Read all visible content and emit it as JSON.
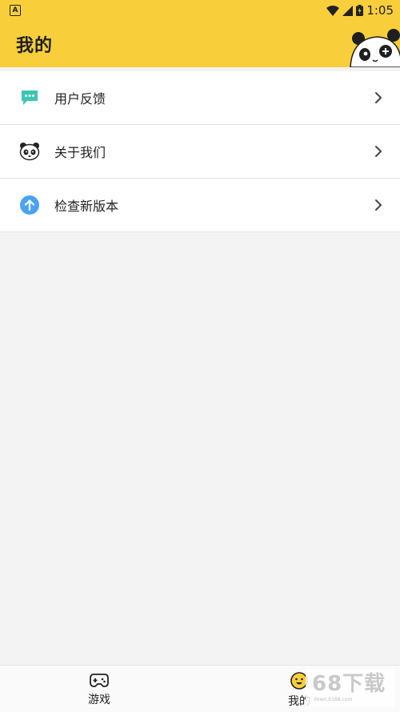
{
  "status_bar": {
    "time": "1:05",
    "notification_icon": "app-notification-icon",
    "notification_letter": "A"
  },
  "header": {
    "title": "我的",
    "background_color": "#f8cf3b",
    "mascot_icon": "panda-mascot-icon"
  },
  "menu": {
    "items": [
      {
        "label": "用户反馈",
        "icon": "feedback-chat-icon",
        "icon_color": "#3cc5b3"
      },
      {
        "label": "关于我们",
        "icon": "panda-icon",
        "icon_color": "#222222"
      },
      {
        "label": "检查新版本",
        "icon": "upload-arrow-icon",
        "icon_color": "#4aa3f0"
      }
    ]
  },
  "bottom_nav": {
    "tabs": [
      {
        "label": "游戏",
        "icon": "gamepad-icon",
        "active": false
      },
      {
        "label": "我的",
        "icon": "smiley-face-icon",
        "active": true
      }
    ]
  },
  "watermark": {
    "text": "68下载",
    "sub": "down.it168.com"
  }
}
